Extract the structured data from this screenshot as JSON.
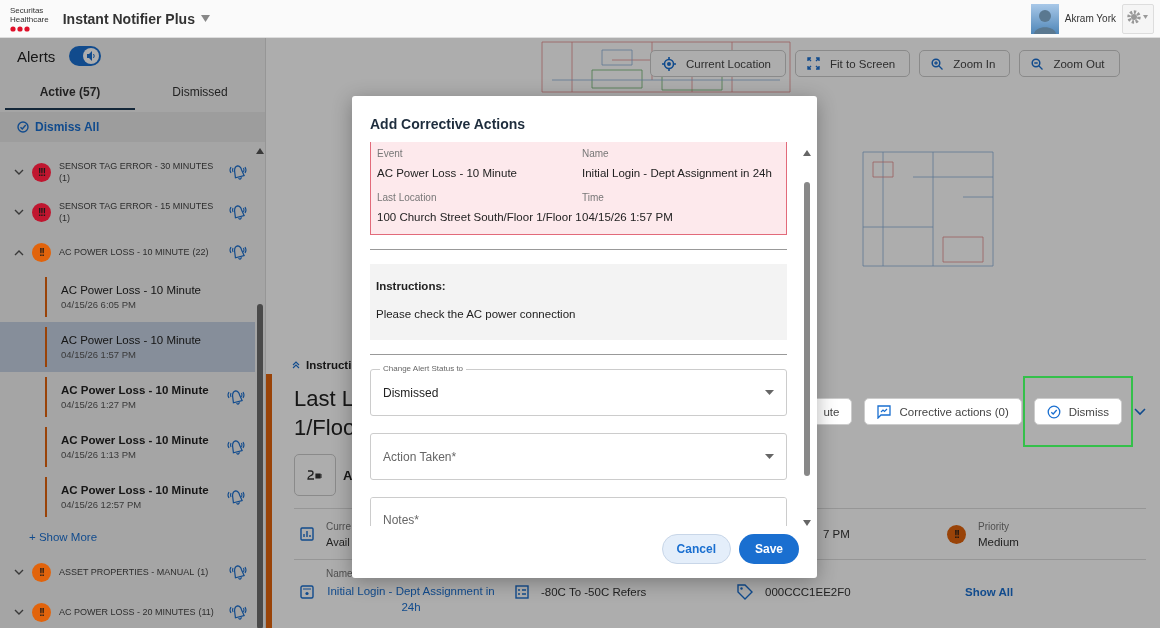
{
  "header": {
    "logo_line1": "Securitas",
    "logo_line2": "Healthcare",
    "app_title": "Instant Notifier Plus",
    "user_name": "Akram York"
  },
  "alerts": {
    "title": "Alerts",
    "sound_on": true,
    "tabs": [
      {
        "label": "Active (57)",
        "selected": true
      },
      {
        "label": "Dismissed",
        "selected": false
      }
    ],
    "dismiss_all": "Dismiss All",
    "groups": [
      {
        "title": "SENSOR TAG ERROR - 30 MINUTES",
        "count": "(1)",
        "badge": "!!!",
        "color": "#c0162f",
        "expanded": false
      },
      {
        "title": "SENSOR TAG ERROR - 15 MINUTES",
        "count": "(1)",
        "badge": "!!!",
        "color": "#c0162f",
        "expanded": false
      },
      {
        "title": "AC POWER LOSS - 10 MINUTE",
        "count": "(22)",
        "badge": "!!",
        "color": "#e2640c",
        "expanded": true,
        "show_more": "+ Show More",
        "items": [
          {
            "title": "AC Power Loss - 10 Minute",
            "time": "04/15/26 6:05 PM",
            "unread": false,
            "selected": false
          },
          {
            "title": "AC Power Loss - 10 Minute",
            "time": "04/15/26 1:57 PM",
            "unread": false,
            "selected": true
          },
          {
            "title": "AC Power Loss - 10 Minute",
            "time": "04/15/26 1:27 PM",
            "unread": true,
            "selected": false
          },
          {
            "title": "AC Power Loss - 10 Minute",
            "time": "04/15/26 1:13 PM",
            "unread": true,
            "selected": false
          },
          {
            "title": "AC Power Loss - 10 Minute",
            "time": "04/15/26 12:57 PM",
            "unread": true,
            "selected": false
          }
        ]
      },
      {
        "title": "ASSET PROPERTIES - MANUAL",
        "count": "(1)",
        "badge": "!!",
        "color": "#e2640c",
        "expanded": false
      },
      {
        "title": "AC POWER LOSS - 20 MINUTES",
        "count": "(11)",
        "badge": "!!",
        "color": "#e2640c",
        "expanded": false
      }
    ]
  },
  "map": {
    "buttons": [
      {
        "kind": "locate",
        "label": "Current Location"
      },
      {
        "kind": "fit",
        "label": "Fit to Screen"
      },
      {
        "kind": "zoom-in",
        "label": "Zoom In"
      },
      {
        "kind": "zoom-out",
        "label": "Zoom Out"
      }
    ]
  },
  "detail": {
    "instructions_toggle": "Instructi",
    "title_line1": "Last L",
    "title_line2": "1/Floo",
    "event_short": "A",
    "actions": [
      {
        "kind": "partial",
        "label": "ute",
        "highlighted": false
      },
      {
        "kind": "corrective",
        "label": "Corrective actions (0)",
        "highlighted": false
      },
      {
        "kind": "dismiss",
        "label": "Dismiss",
        "highlighted": true
      }
    ],
    "rows": [
      [
        {
          "kind": "status",
          "label": "Curre",
          "value": "Avail"
        },
        {
          "kind": "empty"
        },
        {
          "kind": "time",
          "value": "7 PM"
        },
        {
          "kind": "priority",
          "label": "Priority",
          "value": "Medium",
          "badge": "!!"
        }
      ],
      [
        {
          "kind": "name",
          "label": "Name",
          "value": "Initial Login - Dept Assignment in 24h"
        },
        {
          "kind": "category",
          "value": "-80C To -50C Refers"
        },
        {
          "kind": "tag",
          "value": "000CCC1EE2F0"
        },
        {
          "kind": "show-all",
          "value": "Show All"
        }
      ]
    ]
  },
  "modal": {
    "title": "Add Corrective Actions",
    "event_fields": [
      {
        "label": "Event",
        "value": "AC Power Loss - 10 Minute"
      },
      {
        "label": "Name",
        "value": "Initial Login - Dept Assignment in 24h"
      },
      {
        "label": "Last Location",
        "value": "100 Church Street South/Floor 1/Floor 1"
      },
      {
        "label": "Time",
        "value": "04/15/26 1:57 PM"
      }
    ],
    "instructions": {
      "heading": "Instructions:",
      "text": "Please check the AC power connection"
    },
    "status_select": {
      "label": "Change Alert Status to",
      "value": "Dismissed"
    },
    "action_select": {
      "placeholder": "Action Taken*"
    },
    "notes": {
      "placeholder": "Notes*"
    },
    "buttons": [
      {
        "kind": "secondary",
        "label": "Cancel"
      },
      {
        "kind": "primary",
        "label": "Save"
      }
    ]
  }
}
